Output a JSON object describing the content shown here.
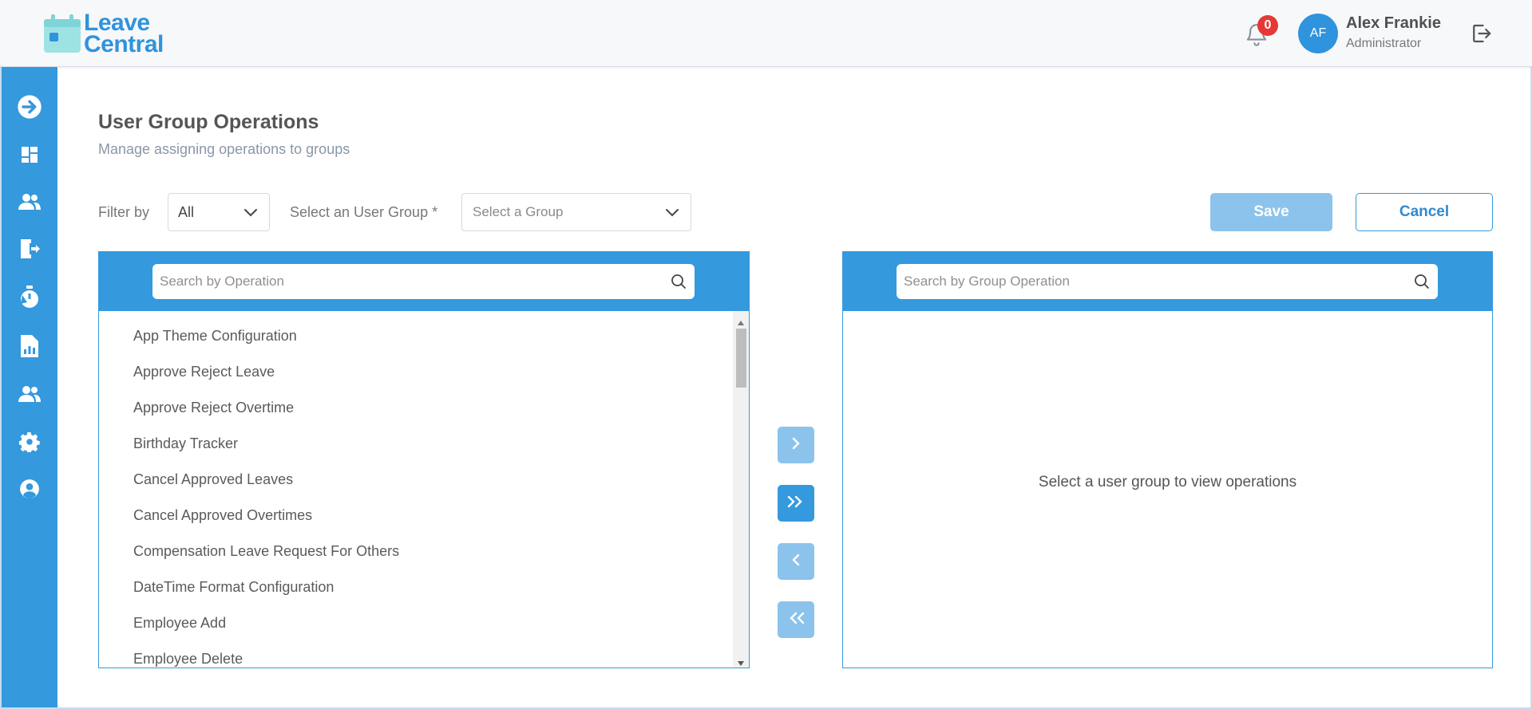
{
  "app": {
    "logo_line1": "Leave",
    "logo_line2": "Central",
    "brand_color": "#2f93dd",
    "accent_color": "#3499dd"
  },
  "header": {
    "notification_count": "0",
    "avatar_initials": "AF",
    "user_name": "Alex Frankie",
    "user_role": "Administrator"
  },
  "sidebar": {
    "items": [
      {
        "icon": "arrow-right-circle-icon"
      },
      {
        "icon": "dashboard-icon"
      },
      {
        "icon": "users-icon"
      },
      {
        "icon": "leave-exit-icon"
      },
      {
        "icon": "overtime-icon"
      },
      {
        "icon": "reports-icon"
      },
      {
        "icon": "groups-icon"
      },
      {
        "icon": "gear-icon"
      },
      {
        "icon": "account-circle-icon"
      }
    ]
  },
  "page": {
    "title": "User Group Operations",
    "subtitle": "Manage assigning operations to groups"
  },
  "filters": {
    "filter_label": "Filter by",
    "filter_value": "All",
    "group_label": "Select an User Group *",
    "group_placeholder": "Select a Group"
  },
  "actions": {
    "save_label": "Save",
    "cancel_label": "Cancel"
  },
  "left_panel": {
    "search_placeholder": "Search by Operation",
    "operations": [
      "App Theme Configuration",
      "Approve Reject Leave",
      "Approve Reject Overtime",
      "Birthday Tracker",
      "Cancel Approved Leaves",
      "Cancel Approved Overtimes",
      "Compensation Leave Request For Others",
      "DateTime Format Configuration",
      "Employee Add",
      "Employee Delete"
    ]
  },
  "right_panel": {
    "search_placeholder": "Search by Group Operation",
    "empty_message": "Select a user group to view operations"
  },
  "transfer_buttons": [
    {
      "name": "move-selected-right-button",
      "icon": "chevron-right-icon",
      "enabled": false
    },
    {
      "name": "move-all-right-button",
      "icon": "double-chevron-right-icon",
      "enabled": true
    },
    {
      "name": "move-selected-left-button",
      "icon": "chevron-left-icon",
      "enabled": false
    },
    {
      "name": "move-all-left-button",
      "icon": "double-chevron-left-icon",
      "enabled": false
    }
  ]
}
